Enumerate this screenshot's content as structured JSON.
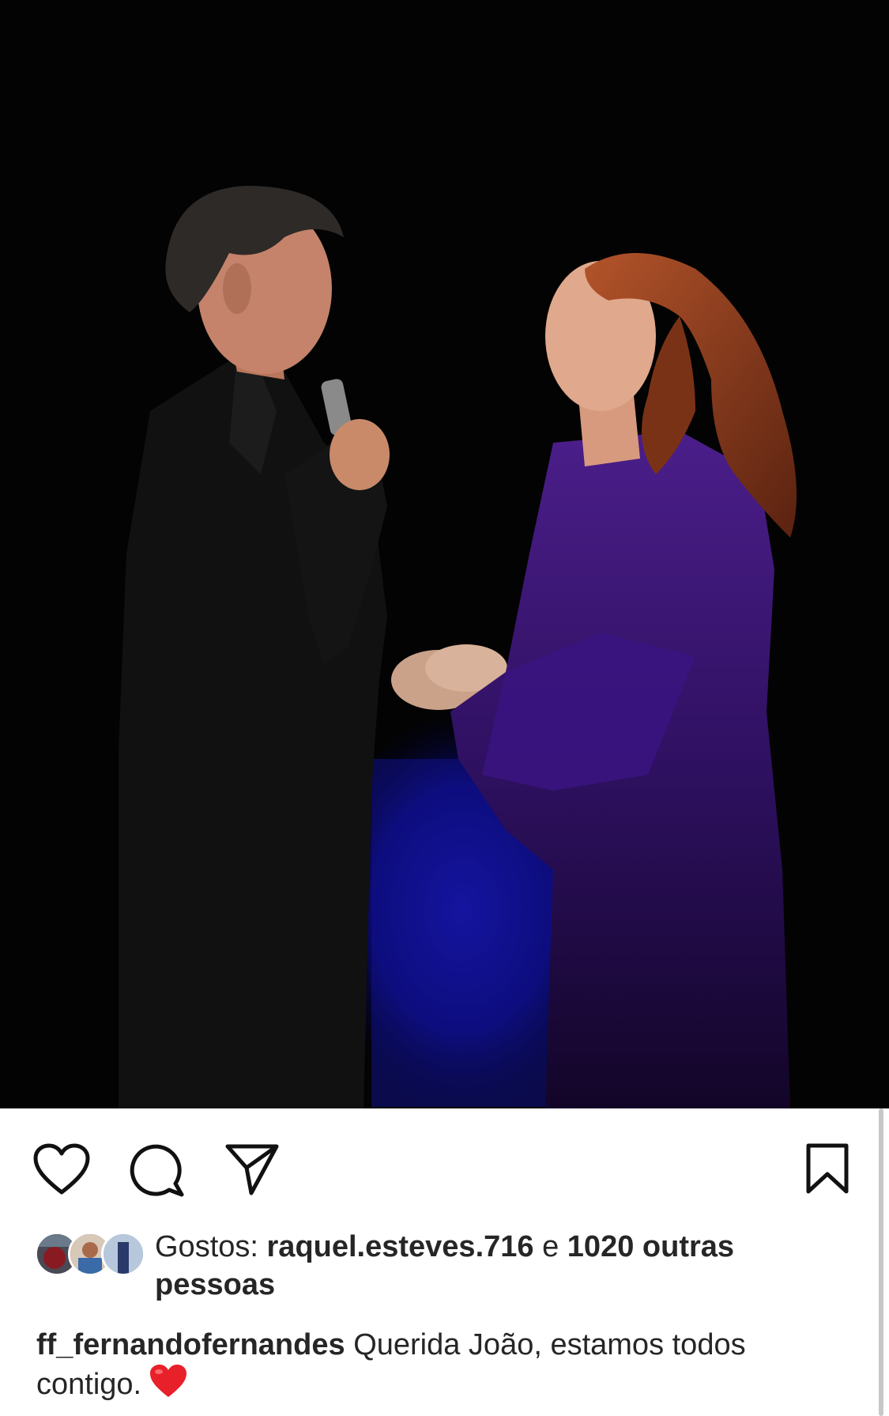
{
  "post": {
    "image_alt": "",
    "actions": {
      "like_icon": "heart-outline-icon",
      "comment_icon": "comment-bubble-icon",
      "share_icon": "paper-plane-icon",
      "save_icon": "bookmark-outline-icon"
    },
    "likes": {
      "prefix": "Gostos:",
      "first_liker": "raquel.esteves.716",
      "connector": "e",
      "others": "1020 outras pessoas"
    },
    "caption": {
      "username": "ff_fernandofernandes",
      "text": "Querida João, estamos todos contigo.",
      "emoji_icon": "red-heart-emoji-icon"
    }
  },
  "colors": {
    "text": "#262626",
    "background": "#ffffff",
    "emoji_heart": "#e8202a"
  }
}
